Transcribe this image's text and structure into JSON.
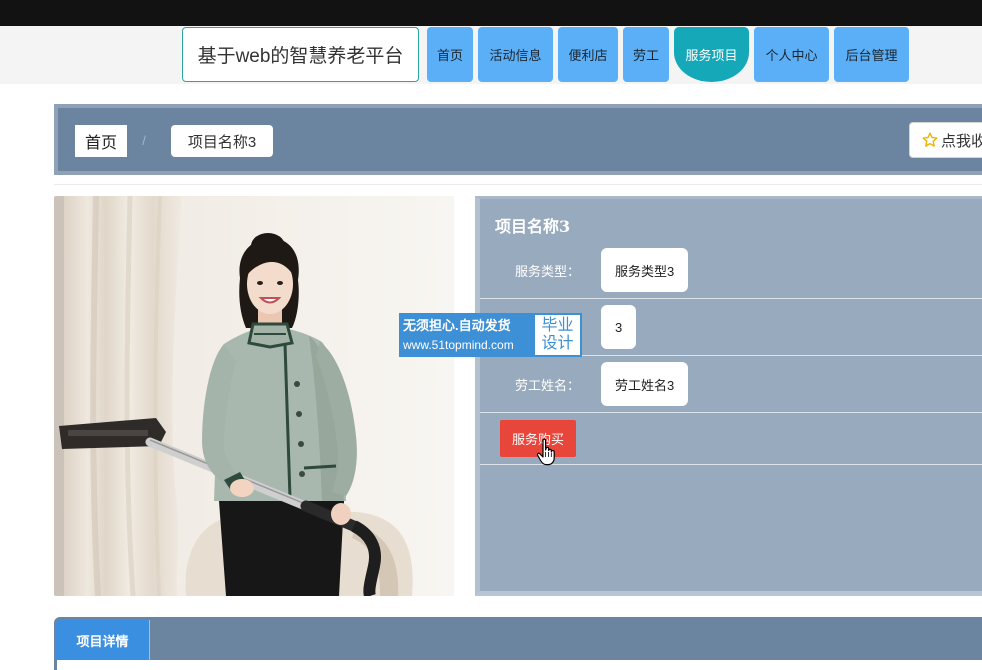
{
  "header": {
    "title": "基于web的智慧养老平台",
    "nav": [
      {
        "label": "首页"
      },
      {
        "label": "活动信息"
      },
      {
        "label": "便利店"
      },
      {
        "label": "劳工"
      },
      {
        "label": "服务项目",
        "active": true
      },
      {
        "label": "个人中心"
      },
      {
        "label": "后台管理"
      }
    ]
  },
  "breadcrumb": {
    "home": "首页",
    "separator": "/",
    "current": "项目名称3"
  },
  "favorite_button": {
    "icon": "star-outline-icon",
    "label": "点我收"
  },
  "product": {
    "title": "项目名称3",
    "fields": [
      {
        "label": "服务类型：",
        "value": "服务类型3"
      },
      {
        "value": "3"
      },
      {
        "label": "劳工姓名：",
        "value": "劳工姓名3"
      }
    ],
    "buy_button": "服务购买"
  },
  "watermark": {
    "line1": "无须担心.自动发货",
    "line2": "www.51topmind.com",
    "badge_top": "毕业",
    "badge_bottom": "设计"
  },
  "tabs": [
    {
      "label": "项目详情",
      "active": true
    }
  ],
  "cursor": {
    "icon": "hand-pointer-icon"
  },
  "colors": {
    "nav": "#5aaff7",
    "nav_active": "#15a8b9",
    "bar": "#6b849f",
    "detail_panel": "#98aabe",
    "buy_button": "#e8463b",
    "tab_active": "#3a8fe0",
    "star": "#f0b400",
    "watermark": "#3d8fd6"
  }
}
